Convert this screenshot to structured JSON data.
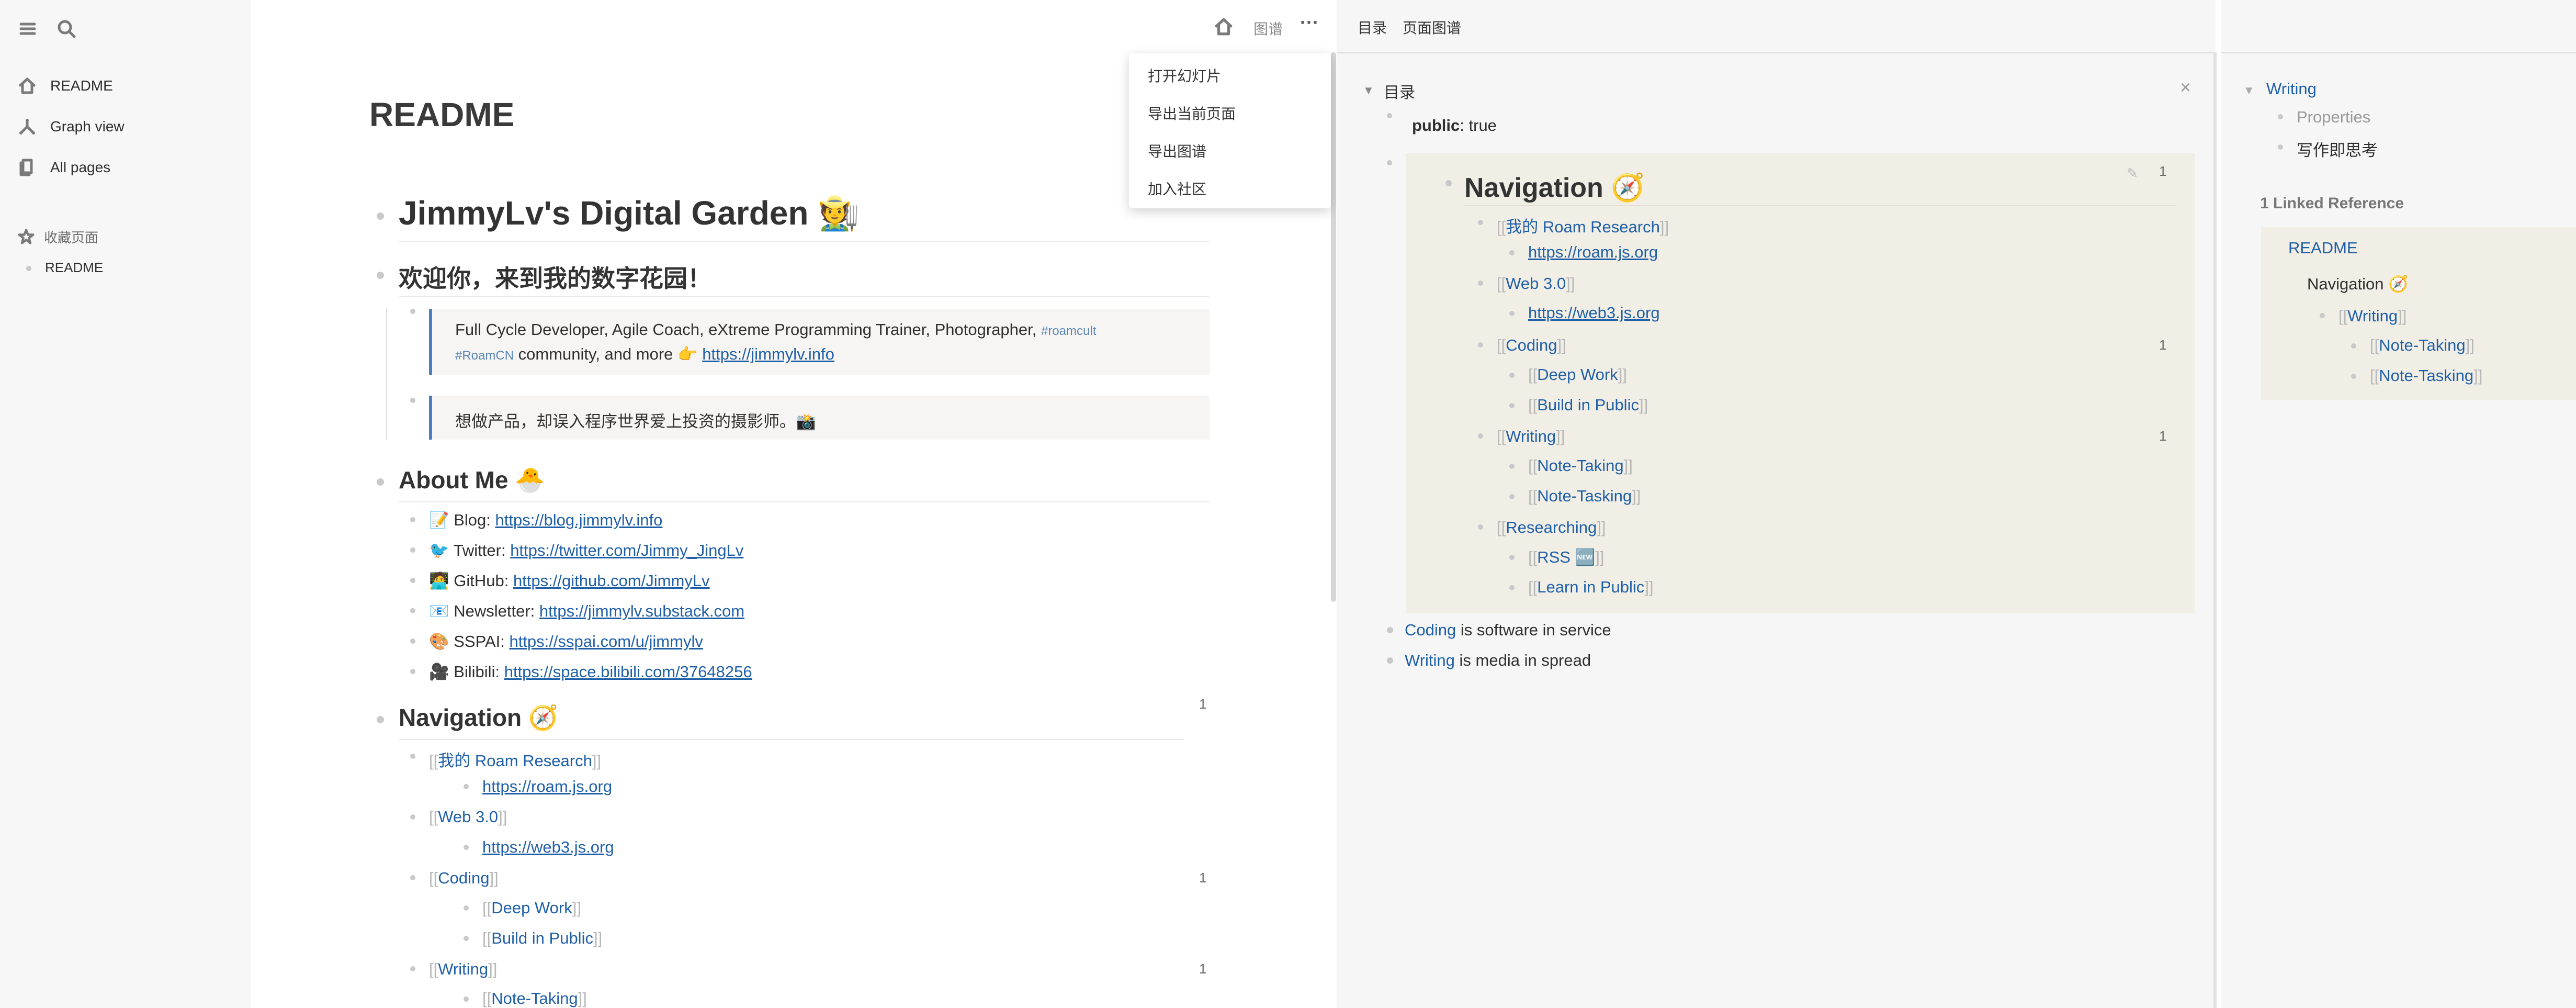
{
  "sidebar": {
    "items": [
      {
        "label": "README",
        "icon": "home-icon"
      },
      {
        "label": "Graph view",
        "icon": "graph-icon"
      },
      {
        "label": "All pages",
        "icon": "pages-icon"
      }
    ],
    "favorites_title": "收藏页面",
    "favorites": [
      "README"
    ]
  },
  "header": {
    "graph_label": "图谱",
    "more_label": "···"
  },
  "menu": {
    "items": [
      "打开幻灯片",
      "导出当前页面",
      "导出图谱",
      "加入社区"
    ]
  },
  "page": {
    "title": "README",
    "h1": "JimmyLv's Digital Garden 🧑‍🌾",
    "h2": "欢迎你，来到我的数字花园！",
    "quote1": {
      "text": "Full Cycle Developer, Agile Coach, eXtreme Programming Trainer, Photographer,",
      "tag1": "#roamcult",
      "tag2": "#RoamCN",
      "suffix": "community, and more 👉",
      "link": "https://jimmylv.info"
    },
    "quote2": "想做产品，却误入程序世界爱上投资的摄影师。📸",
    "about": {
      "title": "About Me 🐣",
      "items": [
        {
          "label": "📝 Blog:",
          "link": "https://blog.jimmylv.info"
        },
        {
          "label": "🐦 Twitter:",
          "link": "https://twitter.com/Jimmy_JingLv"
        },
        {
          "label": "🧑‍💻 GitHub:",
          "link": "https://github.com/JimmyLv"
        },
        {
          "label": "📧 Newsletter:",
          "link": "https://jimmylv.substack.com"
        },
        {
          "label": "🎨 SSPAI:",
          "link": "https://sspai.com/u/jimmylv"
        },
        {
          "label": "🎥 Bilibili:",
          "link": "https://space.bilibili.com/37648256"
        }
      ]
    },
    "navigation": {
      "title": "Navigation 🧭",
      "count": "1",
      "roam": "我的 Roam Research",
      "roam_link": "https://roam.js.org",
      "web3": "Web 3.0",
      "web3_link": "https://web3.js.org",
      "coding": "Coding",
      "coding_count": "1",
      "deep_work": "Deep Work",
      "build": "Build in Public",
      "writing": "Writing",
      "writing_count": "1",
      "note_taking": "Note-Taking"
    }
  },
  "toc": {
    "tab1": "目录",
    "tab2": "页面图谱",
    "title": "目录",
    "close": "×",
    "prop_key": "public",
    "prop_val": ": true",
    "nav_title": "Navigation 🧭",
    "nav_count": "1",
    "items": {
      "roam": "我的 Roam Research",
      "roam_link": "https://roam.js.org",
      "web3": "Web 3.0",
      "web3_link": "https://web3.js.org",
      "coding": "Coding",
      "coding_count": "1",
      "deep_work": "Deep Work",
      "build": "Build in Public",
      "writing": "Writing",
      "writing_count": "1",
      "note_taking": "Note-Taking",
      "note_tasking": "Note-Tasking",
      "researching": "Researching",
      "rss": "RSS 🆕",
      "learn": "Learn in Public"
    },
    "coding_line": {
      "ref": "Coding",
      "text": "is software in service"
    },
    "writing_line": {
      "ref": "Writing",
      "text": "is media in spread"
    }
  },
  "refs": {
    "page": "Writing",
    "properties": "Properties",
    "thought": "写作即思考",
    "linked_title": "1 Linked Reference",
    "ref_page": "README",
    "ref_nav": "Navigation 🧭",
    "writing": "Writing",
    "note_taking": "Note-Taking",
    "note_tasking": "Note-Tasking"
  }
}
